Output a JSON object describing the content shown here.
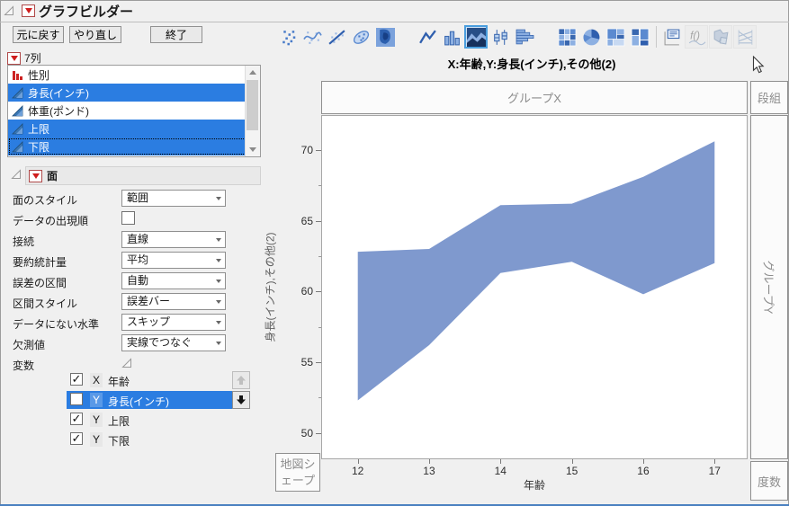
{
  "window": {
    "title": "グラフビルダー"
  },
  "actions": {
    "undo": "元に戻す",
    "redo": "やり直し",
    "done": "終了"
  },
  "palette": {
    "selected": "area",
    "items": [
      {
        "icon": "points",
        "enabled": true
      },
      {
        "icon": "smoother",
        "enabled": true
      },
      {
        "icon": "line-of-fit",
        "enabled": true
      },
      {
        "icon": "ellipse",
        "enabled": true
      },
      {
        "icon": "contour",
        "enabled": true
      },
      {
        "icon": "gap"
      },
      {
        "icon": "line",
        "enabled": true
      },
      {
        "icon": "bar",
        "enabled": true
      },
      {
        "icon": "area",
        "enabled": true
      },
      {
        "icon": "box-plot",
        "enabled": true
      },
      {
        "icon": "histogram",
        "enabled": true
      },
      {
        "icon": "gap"
      },
      {
        "icon": "heatmap",
        "enabled": true
      },
      {
        "icon": "pie",
        "enabled": true
      },
      {
        "icon": "treemap",
        "enabled": true
      },
      {
        "icon": "mosaic",
        "enabled": true
      },
      {
        "icon": "sep"
      },
      {
        "icon": "caption-box",
        "enabled": true
      },
      {
        "icon": "formula",
        "enabled": false
      },
      {
        "icon": "map-shapes",
        "enabled": false
      },
      {
        "icon": "parallel-plot",
        "enabled": false
      }
    ]
  },
  "columns": {
    "header": "7列",
    "items": [
      {
        "label": "性別",
        "type": "nominal",
        "selected": false,
        "focused": false
      },
      {
        "label": "身長(インチ)",
        "type": "continuous",
        "selected": true,
        "focused": false
      },
      {
        "label": "体重(ポンド)",
        "type": "continuous",
        "selected": false,
        "focused": false
      },
      {
        "label": "上限",
        "type": "continuous",
        "selected": true,
        "focused": false
      },
      {
        "label": "下限",
        "type": "continuous",
        "selected": true,
        "focused": true
      }
    ]
  },
  "properties": {
    "header": "面",
    "rows": [
      {
        "label": "面のスタイル",
        "control": "select",
        "value": "範囲"
      },
      {
        "label": "データの出現順",
        "control": "checkbox",
        "checked": false
      },
      {
        "label": "接続",
        "control": "select",
        "value": "直線"
      },
      {
        "label": "要約統計量",
        "control": "select",
        "value": "平均"
      },
      {
        "label": "誤差の区間",
        "control": "select",
        "value": "自動"
      },
      {
        "label": "区間スタイル",
        "control": "select",
        "value": "誤差バー"
      },
      {
        "label": "データにない水準",
        "control": "select",
        "value": "スキップ"
      },
      {
        "label": "欠測値",
        "control": "select",
        "value": "実線でつなぐ"
      },
      {
        "label": "変数",
        "control": "collapse"
      }
    ]
  },
  "variables": [
    {
      "checked": true,
      "axis": "X",
      "label": "年齢",
      "selected": false,
      "button": "up",
      "button_enabled": false
    },
    {
      "checked": false,
      "axis": "Y",
      "label": "身長(インチ)",
      "selected": true,
      "button": "down",
      "button_enabled": true
    },
    {
      "checked": true,
      "axis": "Y",
      "label": "上限",
      "selected": false
    },
    {
      "checked": true,
      "axis": "Y",
      "label": "下限",
      "selected": false
    }
  ],
  "graph": {
    "title": "X:年齢,Y:身長(インチ),その他(2)",
    "zones": {
      "top": "グループX",
      "top_right": "段組",
      "right": "グループY",
      "bottom_right": "度数",
      "bottom_left": "地図シェープ"
    }
  },
  "chart_data": {
    "type": "area",
    "subtype": "range-band",
    "title": "X:年齢,Y:身長(インチ),その他(2)",
    "x": [
      12,
      13,
      14,
      15,
      16,
      17
    ],
    "series": [
      {
        "name": "上限",
        "values": [
          62.8,
          63.0,
          66.1,
          66.2,
          68.1,
          70.6
        ]
      },
      {
        "name": "下限",
        "values": [
          52.3,
          56.2,
          61.3,
          62.1,
          59.8,
          62.0
        ]
      }
    ],
    "xlabel": "年齢",
    "ylabel": "身長(インチ),その他(2)",
    "xlim": [
      11.5,
      17.45
    ],
    "ylim": [
      48.2,
      72.4
    ],
    "xticks": [
      12,
      13,
      14,
      15,
      16,
      17
    ],
    "yticks": [
      50,
      55,
      60,
      65,
      70
    ],
    "yticks_minor": [
      52.5,
      57.5,
      62.5,
      67.5
    ],
    "grid": false,
    "legend": "none",
    "fill": "#7f99ce"
  },
  "colors": {
    "selection_blue": "#2b7de1",
    "band_fill": "#7f99ce",
    "zone_text": "#8c8c8c",
    "window_bottom_edge": "#4a80c0"
  }
}
